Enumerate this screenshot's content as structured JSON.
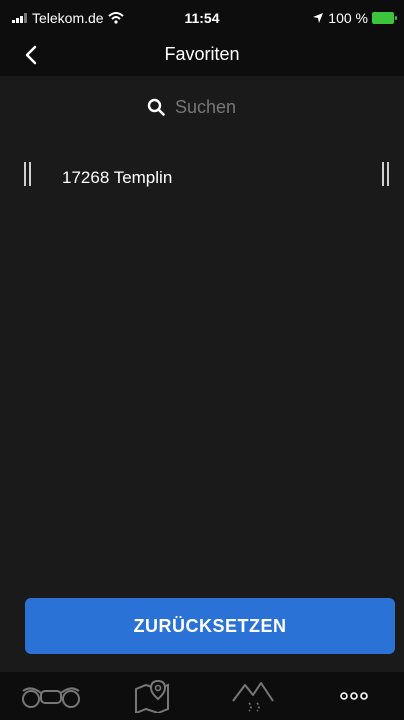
{
  "status_bar": {
    "carrier": "Telekom.de",
    "time": "11:54",
    "battery_text": "100 %"
  },
  "nav": {
    "title": "Favoriten"
  },
  "search": {
    "placeholder": "Suchen"
  },
  "favorites": [
    {
      "label": "17268 Templin"
    }
  ],
  "reset_button": {
    "label": "ZURÜCKSETZEN"
  },
  "tab_bar": {
    "tabs": [
      {
        "icon": "motorcycle-icon"
      },
      {
        "icon": "map-pin-icon"
      },
      {
        "icon": "mountain-route-icon"
      },
      {
        "icon": "more-dots-icon"
      }
    ]
  },
  "colors": {
    "background": "#1a1a1a",
    "bar": "#0d0d0d",
    "accent": "#2b72d6",
    "battery": "#3cc43c"
  }
}
